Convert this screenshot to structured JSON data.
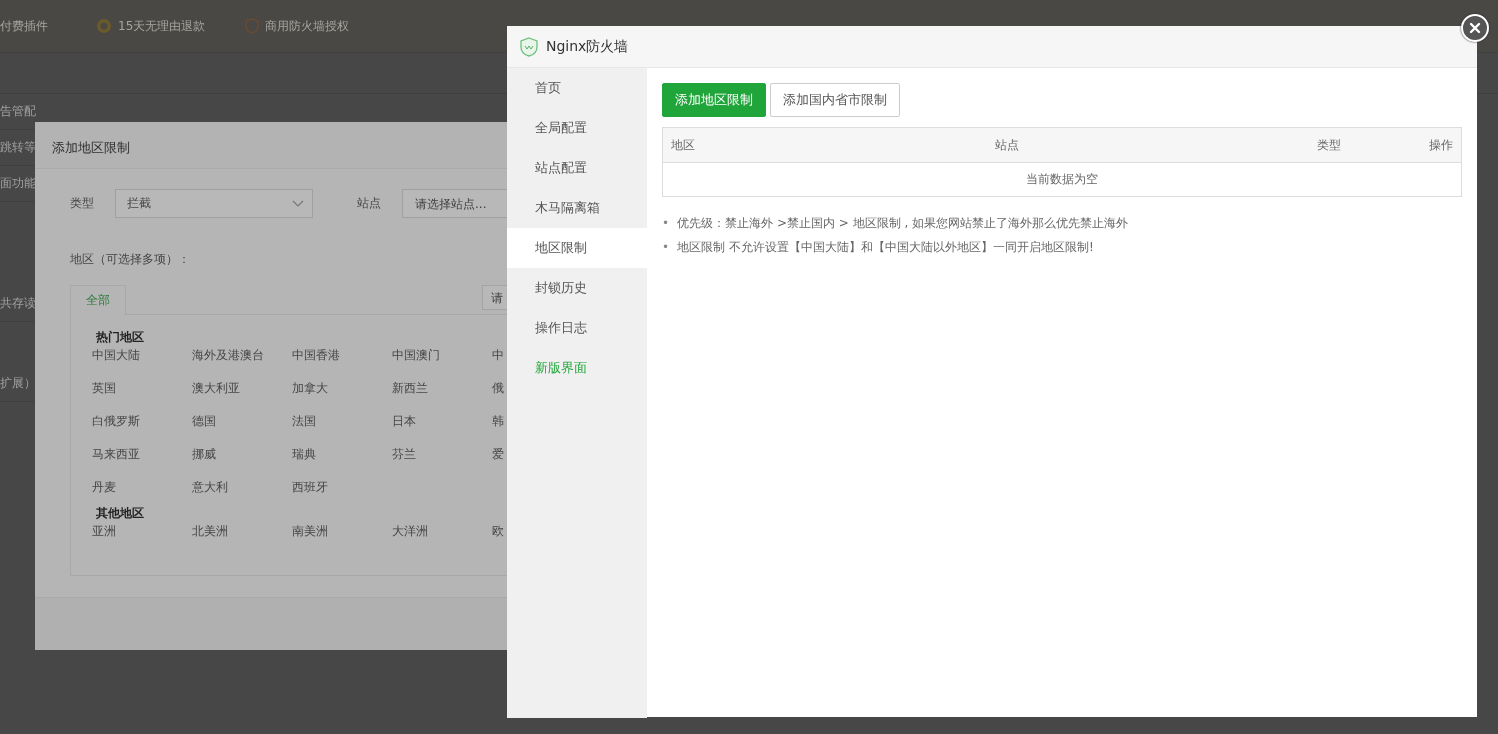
{
  "background": {
    "top_bar": [
      {
        "text": "付费插件"
      },
      {
        "text": "15天无理由退款"
      },
      {
        "text": "商用防火墙授权"
      }
    ],
    "side_texts": [
      "告管配",
      "跳转等",
      "面功能",
      "共存读",
      "扩展）"
    ]
  },
  "region_dialog": {
    "title": "添加地区限制",
    "type_label": "类型",
    "type_value": "拦截",
    "site_label": "站点",
    "site_placeholder": "请选择站点...",
    "region_label": "地区（可选择多项）：",
    "tabs": [
      {
        "label": "全部",
        "selected": true
      }
    ],
    "search_placeholder": "请",
    "groups": [
      {
        "title": "热门地区",
        "items": [
          "中国大陆",
          "海外及港澳台",
          "中国香港",
          "中国澳门",
          "中",
          "英国",
          "澳大利亚",
          "加拿大",
          "新西兰",
          "俄",
          "白俄罗斯",
          "德国",
          "法国",
          "日本",
          "韩",
          "马来西亚",
          "挪威",
          "瑞典",
          "芬兰",
          "爱",
          "丹麦",
          "意大利",
          "西班牙"
        ]
      },
      {
        "title": "其他地区",
        "items": [
          "亚洲",
          "北美洲",
          "南美洲",
          "大洋洲",
          "欧"
        ]
      }
    ]
  },
  "firewall": {
    "title": "Nginx防火墙",
    "nav": [
      {
        "label": "首页",
        "selected": false,
        "kind": "item"
      },
      {
        "label": "全局配置",
        "selected": false,
        "kind": "item"
      },
      {
        "label": "站点配置",
        "selected": false,
        "kind": "item"
      },
      {
        "label": "木马隔离箱",
        "selected": false,
        "kind": "item"
      },
      {
        "label": "地区限制",
        "selected": true,
        "kind": "item"
      },
      {
        "label": "封锁历史",
        "selected": false,
        "kind": "item"
      },
      {
        "label": "操作日志",
        "selected": false,
        "kind": "item"
      },
      {
        "label": "新版界面",
        "selected": false,
        "kind": "link"
      }
    ],
    "buttons": [
      {
        "label": "添加地区限制",
        "kind": "primary"
      },
      {
        "label": "添加国内省市限制",
        "kind": "default"
      }
    ],
    "table": {
      "columns": [
        "地区",
        "站点",
        "类型",
        "操作"
      ],
      "empty_text": "当前数据为空"
    },
    "notes": [
      {
        "marker": "•",
        "text": "优先级：禁止海外 >禁止国内 > 地区限制 , 如果您网站禁止了海外那么优先禁止海外"
      },
      {
        "marker": "•",
        "text": "地区限制 不允许设置【中国大陆】和【中国大陆以外地区】一同开启地区限制!"
      }
    ]
  }
}
